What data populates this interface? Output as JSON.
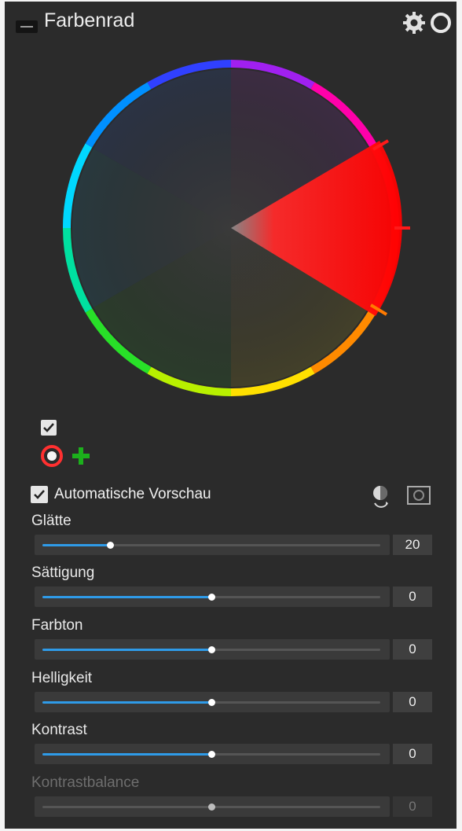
{
  "header": {
    "title": "Farbenrad"
  },
  "preview": {
    "auto_label": "Automatische Vorschau",
    "auto_checked": true
  },
  "sliders": [
    {
      "label": "Glätte",
      "value": "20",
      "fraction": 0.2,
      "filled": true
    },
    {
      "label": "Sättigung",
      "value": "0",
      "fraction": 0.5,
      "filled": true
    },
    {
      "label": "Farbton",
      "value": "0",
      "fraction": 0.5,
      "filled": true
    },
    {
      "label": "Helligkeit",
      "value": "0",
      "fraction": 0.5,
      "filled": true
    },
    {
      "label": "Kontrast",
      "value": "0",
      "fraction": 0.5,
      "filled": true
    },
    {
      "label": "Kontrastbalance",
      "value": "0",
      "fraction": 0.5,
      "filled": false,
      "disabled": true
    }
  ],
  "colors": {
    "accent": "#2f9be8",
    "panel": "#2b2b2b",
    "selection": "#ff1a1a"
  }
}
